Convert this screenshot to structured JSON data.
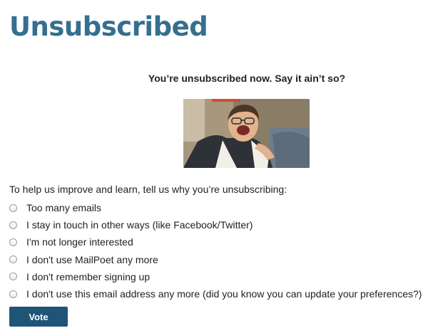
{
  "page": {
    "title": "Unsubscribed"
  },
  "confirmation": {
    "message": "You’re unsubscribed now. Say it ain’t so?"
  },
  "photo": {
    "description": "man-laughing-photo"
  },
  "survey": {
    "prompt": "To help us improve and learn, tell us why you’re unsubscribing:",
    "options": [
      "Too many emails",
      "I stay in touch in other ways (like Facebook/Twitter)",
      "I'm not longer interested",
      "I don't use MailPoet any more",
      "I don't remember signing up",
      "I don't use this email address any more (did you know you can update your preferences?)"
    ],
    "vote_label": "Vote"
  },
  "colors": {
    "title": "#356f8f",
    "button": "#1f5477"
  }
}
